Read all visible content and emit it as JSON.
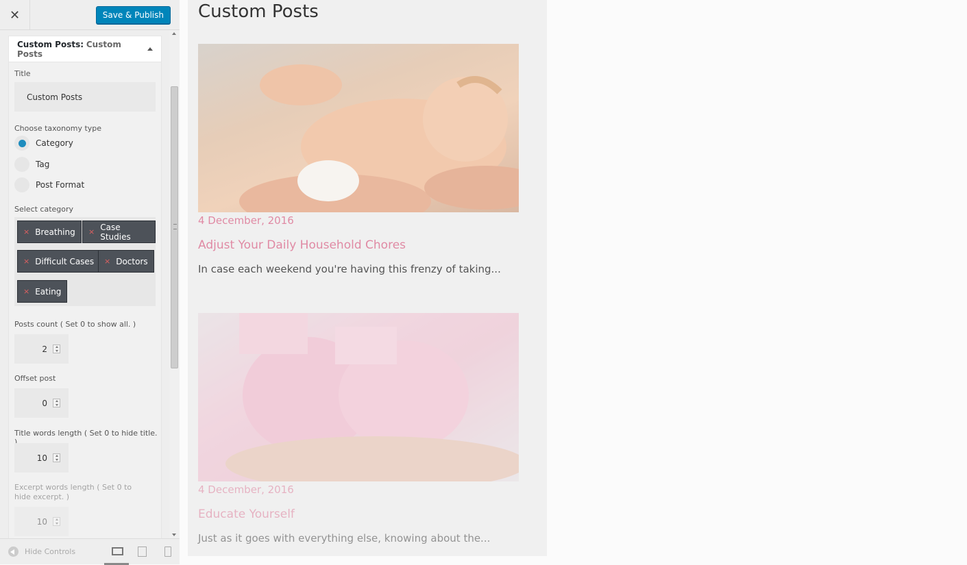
{
  "topbar": {
    "close_icon": "✕",
    "publish_label": "Save & Publish"
  },
  "widget": {
    "header_prefix": "Custom Posts:",
    "header_name": "Custom Posts",
    "title_label": "Title",
    "title_value": "Custom Posts",
    "taxonomy_label": "Choose taxonomy type",
    "taxonomy_options": [
      {
        "label": "Category",
        "selected": true
      },
      {
        "label": "Tag",
        "selected": false
      },
      {
        "label": "Post Format",
        "selected": false
      }
    ],
    "category_label": "Select category",
    "categories": [
      "Breathing",
      "Case Studies",
      "Difficult Cases",
      "Doctors",
      "Eating"
    ],
    "remove_icon": "×",
    "posts_count_label": "Posts count ( Set 0 to show all. )",
    "posts_count": "2",
    "offset_label": "Offset post",
    "offset": "0",
    "title_words_label": "Title words length ( Set 0 to hide title. )",
    "title_words": "10",
    "excerpt_words_label": "Excerpt words length ( Set 0 to hide excerpt. )",
    "excerpt_words": "10"
  },
  "footer": {
    "hide_controls_label": "Hide Controls",
    "devices": [
      "desktop",
      "tablet",
      "mobile"
    ],
    "active_device": "desktop"
  },
  "preview": {
    "title": "Custom Posts",
    "posts": [
      {
        "date": "4 December, 2016",
        "title": "Adjust Your Daily Household Chores",
        "excerpt": "In case each weekend you're having this frenzy of taking...",
        "image": "newborn-baby-in-hands"
      },
      {
        "date": "4 December, 2016",
        "title": "Educate Yourself",
        "excerpt": "Just as it goes with everything else, knowing about the...",
        "image": "pink-baby-booties"
      }
    ]
  },
  "colors": {
    "accent": "#0085ba",
    "post_link": "#e08aa4",
    "tag_bg": "#4d5259",
    "radio_selected": "#1e8cbe"
  }
}
